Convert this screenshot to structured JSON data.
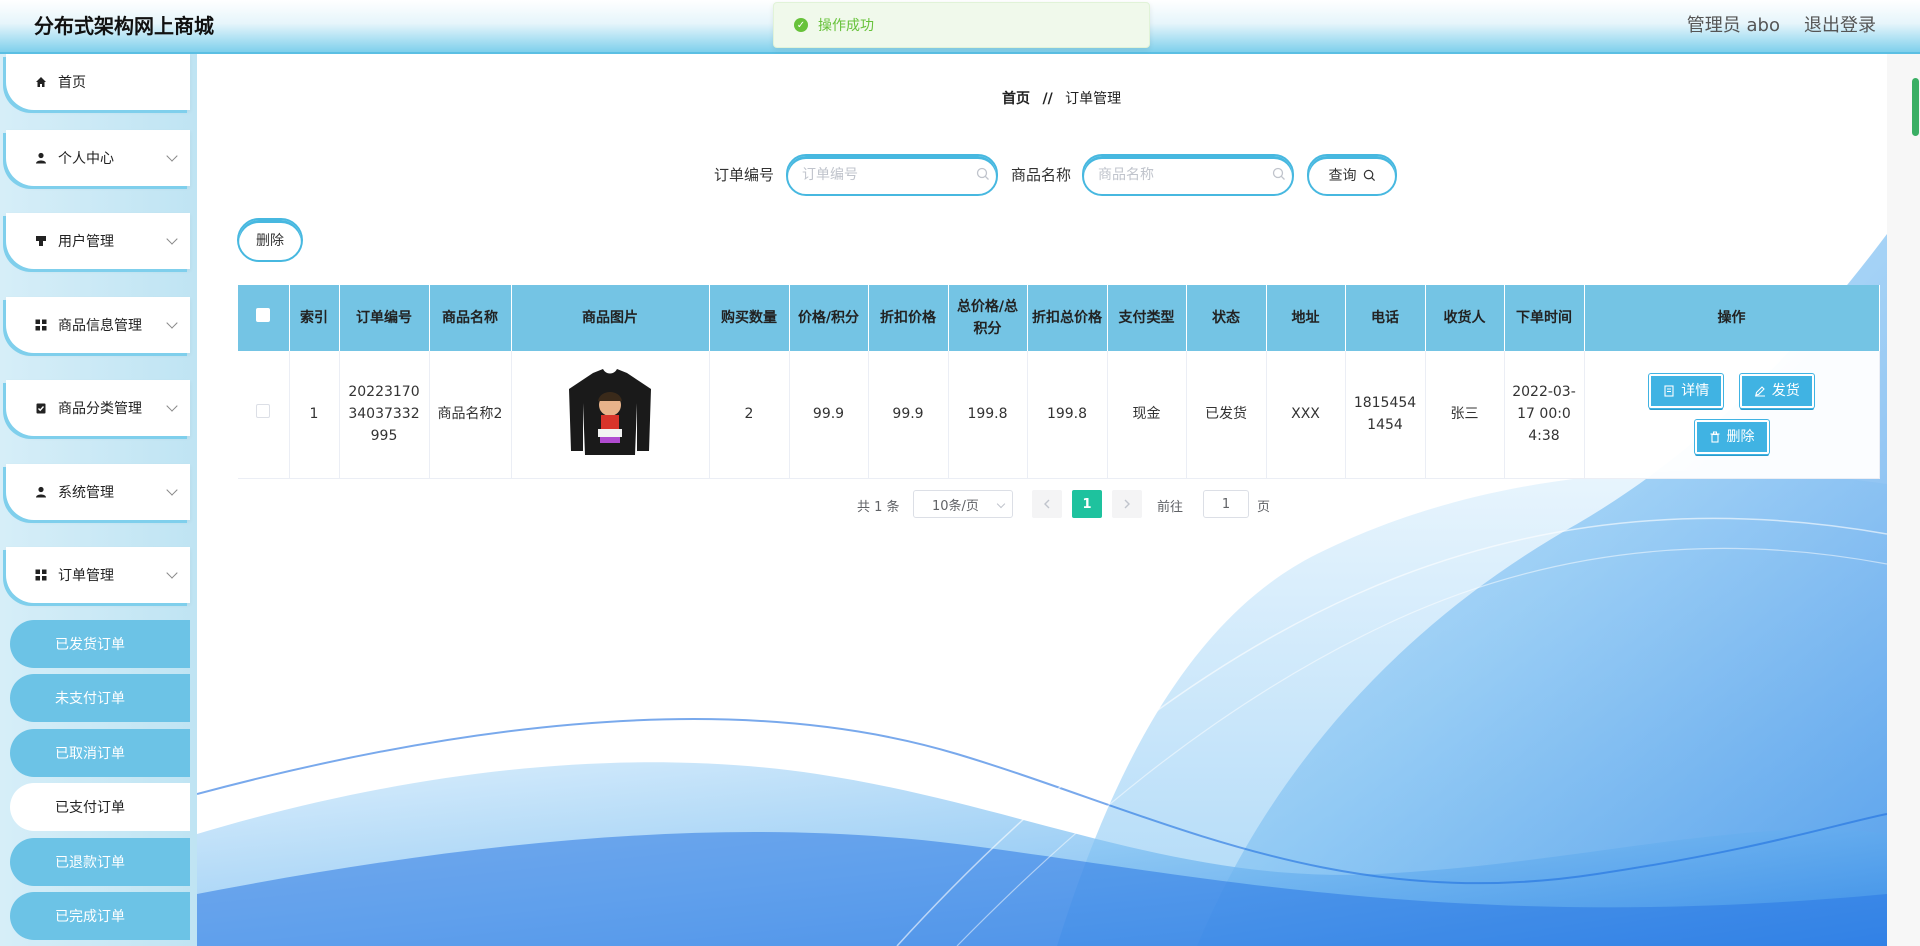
{
  "header": {
    "brand": "分布式架构网上商城",
    "admin_label": "管理员 abo",
    "logout_label": "退出登录"
  },
  "toast": {
    "message": "操作成功"
  },
  "sidebar": {
    "items": [
      {
        "label": "首页",
        "icon": "home-icon"
      },
      {
        "label": "个人中心",
        "icon": "user-icon"
      },
      {
        "label": "用户管理",
        "icon": "users-icon"
      },
      {
        "label": "商品信息管理",
        "icon": "grid-icon"
      },
      {
        "label": "商品分类管理",
        "icon": "clipboard-icon"
      },
      {
        "label": "系统管理",
        "icon": "user-icon"
      },
      {
        "label": "订单管理",
        "icon": "grid-icon"
      }
    ],
    "sub_items": [
      {
        "label": "已发货订单",
        "active": false
      },
      {
        "label": "未支付订单",
        "active": false
      },
      {
        "label": "已取消订单",
        "active": false
      },
      {
        "label": "已支付订单",
        "active": true
      },
      {
        "label": "已退款订单",
        "active": false
      },
      {
        "label": "已完成订单",
        "active": false
      }
    ]
  },
  "breadcrumb": {
    "home": "首页",
    "separator": "//",
    "current": "订单管理"
  },
  "search": {
    "order_no_label": "订单编号",
    "order_no_placeholder": "订单编号",
    "product_name_label": "商品名称",
    "product_name_placeholder": "商品名称",
    "query_label": "查询"
  },
  "toolbar": {
    "delete_label": "删除"
  },
  "table": {
    "columns": [
      "索引",
      "订单编号",
      "商品名称",
      "商品图片",
      "购买数量",
      "价格/积分",
      "折扣价格",
      "总价格/总积分",
      "折扣总价格",
      "支付类型",
      "状态",
      "地址",
      "电话",
      "收货人",
      "下单时间",
      "操作"
    ],
    "rows": [
      {
        "index": "1",
        "order_no": "2022317034037332995",
        "product_name": "商品名称2",
        "quantity": "2",
        "price": "99.9",
        "discount_price": "99.9",
        "total_price": "199.8",
        "discount_total": "199.8",
        "pay_type": "现金",
        "status": "已发货",
        "address": "XXX",
        "phone": "18154541454",
        "receiver": "张三",
        "order_time": "2022-03-17 00:04:38"
      }
    ],
    "actions": {
      "detail": "详情",
      "ship": "发货",
      "delete": "删除"
    }
  },
  "pagination": {
    "total_text": "共 1 条",
    "page_size": "10条/页",
    "current_page": "1",
    "goto_label": "前往",
    "goto_value": "1",
    "page_unit": "页"
  },
  "colors": {
    "accent": "#40b3e3",
    "header_th": "#74c4e4",
    "sidebar_sub": "#6cc3e6",
    "pager_active": "#1ec29e",
    "toast_success": "#67c23a"
  }
}
